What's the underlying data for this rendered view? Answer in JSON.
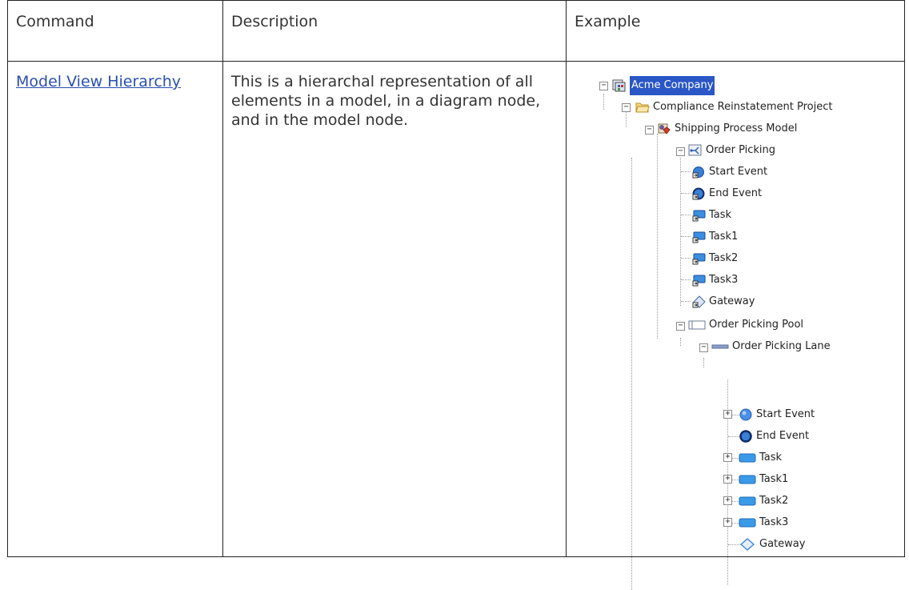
{
  "table": {
    "headers": {
      "command": "Command",
      "description": "Description",
      "example": "Example"
    },
    "row": {
      "command": "Model View Hierarchy",
      "description": "This is a hierarchal representation of all elements in a model, in a diagram node, and in the model node."
    }
  },
  "tree": {
    "root": "Acme Company",
    "project": "Compliance Reinstatement Project",
    "model": "Shipping Process Model",
    "diagram": "Order Picking",
    "diagram_items": [
      "Start Event",
      "End Event",
      "Task",
      "Task1",
      "Task2",
      "Task3",
      "Gateway"
    ],
    "pool": "Order Picking Pool",
    "lane": "Order Picking Lane",
    "lane_items": [
      "Start Event",
      "End Event",
      "Task",
      "Task1",
      "Task2",
      "Task3",
      "Gateway"
    ]
  },
  "colors": {
    "link": "#2a4fb0",
    "selection": "#2a56c6",
    "icon_blue": "#2f7fd8"
  }
}
